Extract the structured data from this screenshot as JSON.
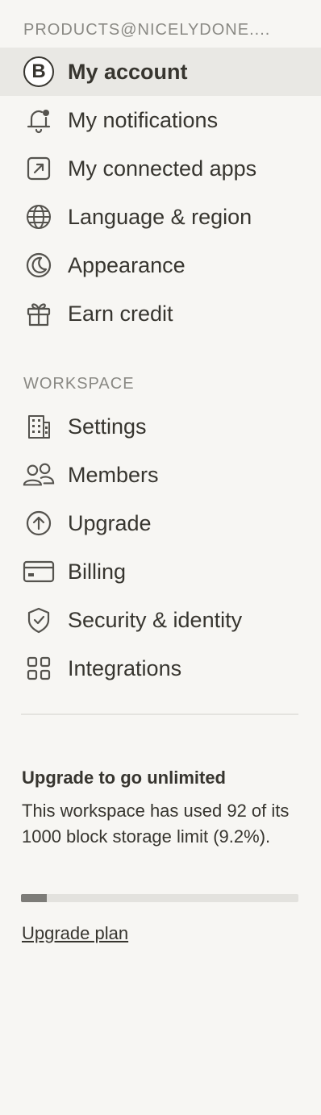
{
  "account_section": {
    "header": "PRODUCTS@NICELYDONE....",
    "avatar_letter": "B",
    "items": [
      {
        "label": "My account",
        "icon": "avatar-icon"
      },
      {
        "label": "My notifications",
        "icon": "bell-icon"
      },
      {
        "label": "My connected apps",
        "icon": "external-link-icon"
      },
      {
        "label": "Language & region",
        "icon": "globe-icon"
      },
      {
        "label": "Appearance",
        "icon": "moon-icon"
      },
      {
        "label": "Earn credit",
        "icon": "gift-icon"
      }
    ]
  },
  "workspace_section": {
    "header": "WORKSPACE",
    "items": [
      {
        "label": "Settings",
        "icon": "building-icon"
      },
      {
        "label": "Members",
        "icon": "people-icon"
      },
      {
        "label": "Upgrade",
        "icon": "arrow-up-circle-icon"
      },
      {
        "label": "Billing",
        "icon": "credit-card-icon"
      },
      {
        "label": "Security & identity",
        "icon": "shield-icon"
      },
      {
        "label": "Integrations",
        "icon": "grid-icon"
      }
    ]
  },
  "upgrade": {
    "title": "Upgrade to go unlimited",
    "text": "This workspace has used 92 of its 1000 block storage limit (9.2%).",
    "progress_percent": 9.2,
    "link": "Upgrade plan"
  },
  "colors": {
    "background": "#f7f6f3",
    "active_background": "#e9e8e4",
    "text": "#37352f",
    "muted": "#8a8984",
    "progress_fill": "#7d7c78"
  }
}
